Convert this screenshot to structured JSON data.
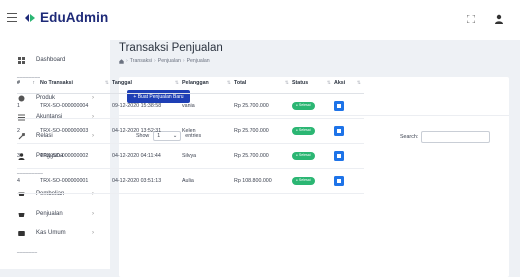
{
  "app": {
    "name": "EduAdmin"
  },
  "sidebar": {
    "items": [
      {
        "label": "Dashboard",
        "icon": "dashboard-icon",
        "has_submenu": false
      },
      {
        "label": "Produk",
        "icon": "box-icon",
        "has_submenu": true
      },
      {
        "label": "Akuntansi",
        "icon": "list-icon",
        "has_submenu": true
      },
      {
        "label": "Relasi",
        "icon": "link-icon",
        "has_submenu": true
      },
      {
        "label": "Pengguna",
        "icon": "user-icon",
        "has_submenu": false
      },
      {
        "label": "Pembelian",
        "icon": "cart-icon",
        "has_submenu": true
      },
      {
        "label": "Penjualan",
        "icon": "bag-icon",
        "has_submenu": true
      },
      {
        "label": "Kas Umum",
        "icon": "wallet-icon",
        "has_submenu": true
      }
    ],
    "chevron": "›"
  },
  "header": {
    "title": "Transaksi Penjualan",
    "breadcrumb": [
      "Transaksi",
      "Penjualan",
      "Penjualan"
    ]
  },
  "toolbar": {
    "new_button_label": "+ Buat Penjualan Baru"
  },
  "table_controls": {
    "show_label": "Show",
    "entries_value": "1",
    "entries_label": "entries",
    "search_label": "Search:"
  },
  "table": {
    "columns": [
      "#",
      "No Transaksi",
      "Tanggal",
      "Pelanggan",
      "Total",
      "Status",
      "Aksi"
    ],
    "rows": [
      {
        "no": "1",
        "transaksi": "TRX-SO-000000004",
        "tanggal": "09-12-2020 15:38:58",
        "pelanggan": "vania",
        "total": "Rp 25.700.000",
        "status": "Selesai"
      },
      {
        "no": "2",
        "transaksi": "TRX-SO-000000003",
        "tanggal": "04-12-2020 13:52:31",
        "pelanggan": "Kelen",
        "total": "Rp 25.700.000",
        "status": "Selesai"
      },
      {
        "no": "3",
        "transaksi": "TRX-SO-000000002",
        "tanggal": "04-12-2020 04:11:44",
        "pelanggan": "Silvya",
        "total": "Rp 25.700.000",
        "status": "Selesai"
      },
      {
        "no": "4",
        "transaksi": "TRX-SO-000000001",
        "tanggal": "04-12-2020 03:51:13",
        "pelanggan": "Aulia",
        "total": "Rp 108.800.000",
        "status": "Selesai"
      }
    ]
  },
  "colors": {
    "primary": "#1e3fb5",
    "success": "#2bb673",
    "action": "#1e73e8",
    "background": "#eef1f5"
  }
}
